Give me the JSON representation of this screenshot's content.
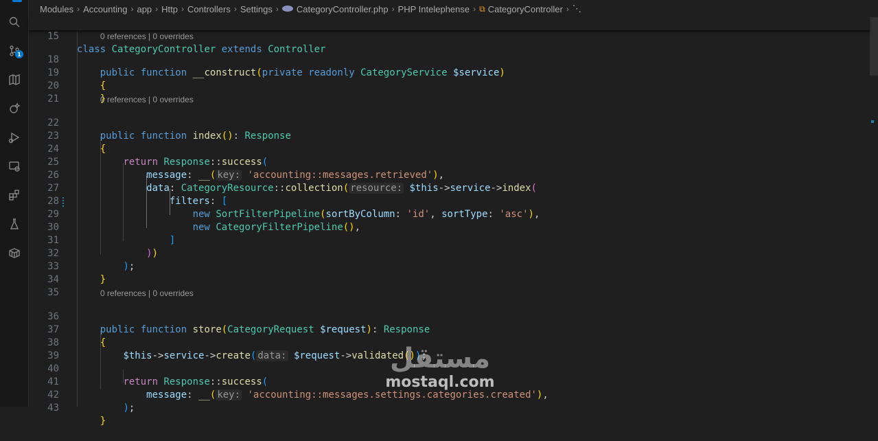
{
  "breadcrumb": {
    "items": [
      "Modules",
      "Accounting",
      "app",
      "Http",
      "Controllers",
      "Settings",
      "CategoryController.php",
      "PHP Intelephense",
      "CategoryController"
    ]
  },
  "code_lens": "0 references | 0 overrides",
  "activity_bar": {
    "icons": [
      "explorer-icon",
      "search-icon",
      "source-control-icon",
      "map-icon",
      "copilot-icon",
      "run-debug-icon",
      "remote-explorer-icon",
      "extensions-icon",
      "testing-icon",
      "containers-icon"
    ],
    "source_control_badge": "1"
  },
  "lines": {
    "l15": {
      "n": "15"
    },
    "l18": {
      "n": "18"
    },
    "l19": {
      "n": "19"
    },
    "l20": {
      "n": "20"
    },
    "l21": {
      "n": "21"
    },
    "l22": {
      "n": "22"
    },
    "l23": {
      "n": "23"
    },
    "l24": {
      "n": "24"
    },
    "l25": {
      "n": "25"
    },
    "l26": {
      "n": "26"
    },
    "l27": {
      "n": "27"
    },
    "l28": {
      "n": "28"
    },
    "l29": {
      "n": "29"
    },
    "l30": {
      "n": "30"
    },
    "l31": {
      "n": "31"
    },
    "l32": {
      "n": "32"
    },
    "l33": {
      "n": "33"
    },
    "l34": {
      "n": "34"
    },
    "l35": {
      "n": "35"
    },
    "l36": {
      "n": "36"
    },
    "l37": {
      "n": "37"
    },
    "l38": {
      "n": "38"
    },
    "l39": {
      "n": "39"
    },
    "l40": {
      "n": "40"
    },
    "l41": {
      "n": "41"
    },
    "l42": {
      "n": "42"
    },
    "l43": {
      "n": "43"
    }
  },
  "tokens": {
    "class": "class",
    "extends": "extends",
    "controller": "Controller",
    "category_controller": "CategoryController",
    "public": "public",
    "function": "function",
    "construct": "__construct",
    "private": "private",
    "readonly": "readonly",
    "category_service": "CategoryService",
    "service_var": "$service",
    "index": "index",
    "response": "Response",
    "return": "return",
    "success": "success",
    "message": "message",
    "trans": "__",
    "key_hint": "key:",
    "retrieved_str": "'accounting::messages.retrieved'",
    "data": "data",
    "category_resource": "CategoryResource",
    "collection": "collection",
    "resource_hint": "resource:",
    "this": "$this",
    "service": "service",
    "filters": "filters",
    "new": "new",
    "sort_pipeline": "SortFilterPipeline",
    "sort_by": "sortByColumn",
    "id_str": "'id'",
    "sort_type": "sortType",
    "asc_str": "'asc'",
    "category_filter_pipeline": "CategoryFilterPipeline",
    "store": "store",
    "category_request": "CategoryRequest",
    "request_var": "$request",
    "create": "create",
    "data_hint": "data:",
    "validated": "validated",
    "created_str": "'accounting::messages.settings.categories.created'"
  },
  "watermark": {
    "arabic": "مستقل",
    "latin": "mostaql.com"
  }
}
